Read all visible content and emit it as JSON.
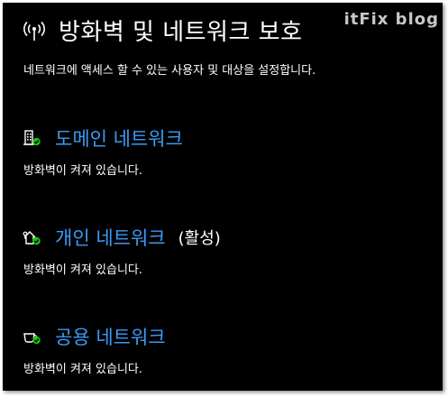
{
  "header": {
    "title": "방화벽 및 네트워크 보호",
    "icon": "wireless-antenna-icon"
  },
  "watermark": "itFix blog",
  "description": "네트워크에 액세스 할 수 있는 사용자 및 대상을 설정합니다.",
  "networks": [
    {
      "name": "도메인 네트워크",
      "icon": "domain-building-icon",
      "active_label": "",
      "status": "방화벽이 켜져 있습니다."
    },
    {
      "name": "개인 네트워크",
      "icon": "private-home-icon",
      "active_label": "(활성)",
      "status": "방화벽이 켜져 있습니다."
    },
    {
      "name": "공용 네트워크",
      "icon": "public-coffee-cup-icon",
      "active_label": "",
      "status": "방화벽이 켜져 있습니다."
    }
  ],
  "colors": {
    "background": "#000000",
    "link": "#3a9bf5",
    "check_badge": "#16c60c"
  }
}
